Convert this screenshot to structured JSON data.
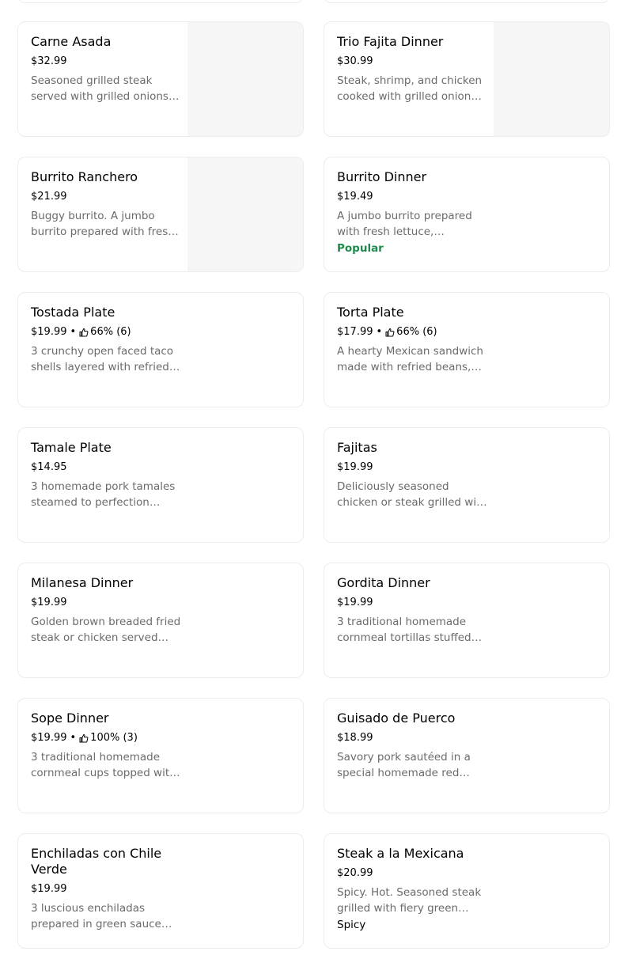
{
  "items": [
    {
      "name": "Carne Asada",
      "price": "$32.99",
      "rating": "",
      "desc": "Seasoned grilled steak served with grilled onions, bell peppers, rice and beans",
      "badge": "",
      "has_image": true
    },
    {
      "name": "Trio Fajita Dinner",
      "price": "$30.99",
      "rating": "",
      "desc": "Steak, shrimp, and chicken cooked with grilled onion and bell peppers",
      "badge": "",
      "has_image": true
    },
    {
      "name": "Burrito Ranchero",
      "price": "$21.99",
      "rating": "",
      "desc": "Buggy burrito. A jumbo burrito prepared with fresh ingredients",
      "badge": "",
      "has_image": true
    },
    {
      "name": "Burrito Dinner",
      "price": "$19.49",
      "rating": "",
      "desc": "A jumbo burrito prepared with fresh lettuce, tomatoes and cheese",
      "badge": "Popular",
      "has_image": false
    },
    {
      "name": "Tostada Plate",
      "price": "$19.99",
      "rating": "66% (6)",
      "desc": "3 crunchy open faced taco shells layered with refried beans",
      "badge": "",
      "has_image": false
    },
    {
      "name": "Torta Plate",
      "price": "$17.99",
      "rating": "66% (6)",
      "desc": "A hearty Mexican sandwich made with refried beans, lettuce and tomato",
      "badge": "",
      "has_image": false
    },
    {
      "name": "Tamale Plate",
      "price": "$14.95",
      "rating": "",
      "desc": "3 homemade pork tamales steamed to perfection served with rice",
      "badge": "",
      "has_image": false
    },
    {
      "name": "Fajitas",
      "price": "$19.99",
      "rating": "",
      "desc": "Deliciously seasoned chicken or steak grilled with onions and peppers",
      "badge": "",
      "has_image": false
    },
    {
      "name": "Milanesa Dinner",
      "price": "$19.99",
      "rating": "",
      "desc": "Golden brown breaded fried steak or chicken served with rice and beans",
      "badge": "",
      "has_image": false
    },
    {
      "name": "Gordita Dinner",
      "price": "$19.99",
      "rating": "",
      "desc": "3 traditional homemade cornmeal tortillas stuffed with meat",
      "badge": "",
      "has_image": false
    },
    {
      "name": "Sope Dinner",
      "price": "$19.99",
      "rating": "100% (3)",
      "desc": "3 traditional homemade cornmeal cups topped with beans and meat",
      "badge": "",
      "has_image": false
    },
    {
      "name": "Guisado de Puerco",
      "price": "$18.99",
      "rating": "",
      "desc": "Savory pork sautéed in a special homemade red sauce",
      "badge": "",
      "has_image": false
    },
    {
      "name": "Enchiladas con Chile Verde",
      "price": "$19.99",
      "rating": "",
      "desc": "3 luscious enchiladas prepared in green sauce and topped with cheese",
      "badge": "",
      "has_image": false
    },
    {
      "name": "Steak a la Mexicana",
      "price": "$20.99",
      "rating": "",
      "desc": "Spicy. Hot. Seasoned steak grilled with fiery green peppers",
      "badge": "Spicy",
      "has_image": false
    }
  ],
  "rating_icon": "thumbs-up-icon",
  "separator": "•",
  "colors": {
    "popular": "#1f8a4c",
    "description": "#6b6b6b",
    "image_placeholder": "#f6f6f6"
  }
}
